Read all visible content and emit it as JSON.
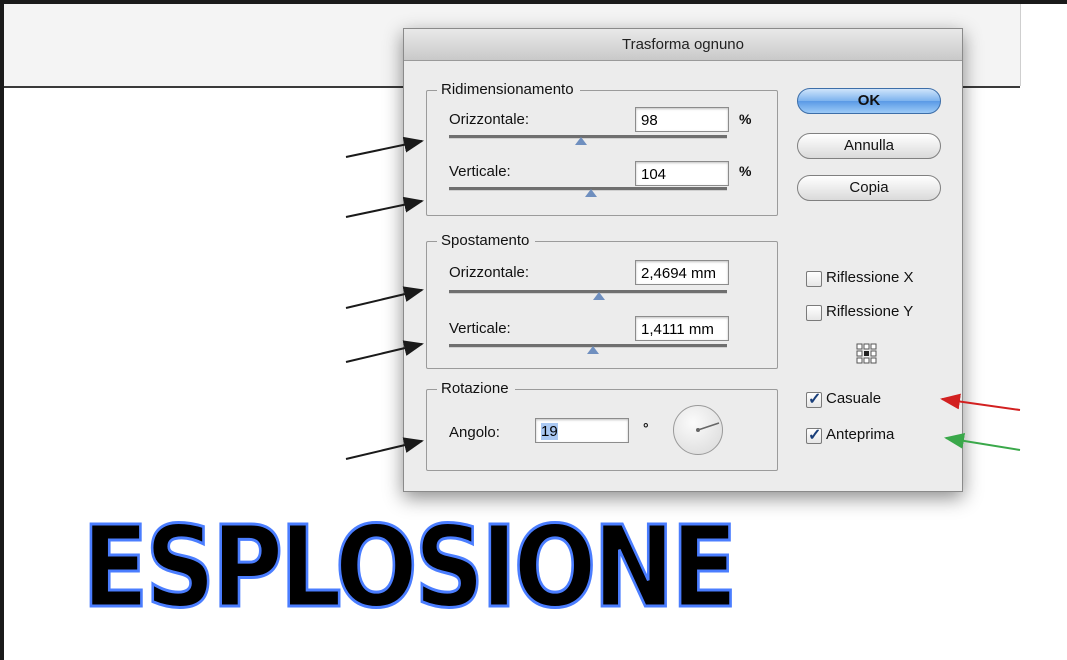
{
  "dialog": {
    "title": "Trasforma ognuno",
    "scale": {
      "label": "Ridimensionamento",
      "horizontal_label": "Orizzontale:",
      "horizontal_value": "98",
      "horizontal_unit": "%",
      "horizontal_slider_level": 0.49,
      "vertical_label": "Verticale:",
      "vertical_value": "104",
      "vertical_unit": "%",
      "vertical_slider_level": 0.52
    },
    "move": {
      "label": "Spostamento",
      "horizontal_label": "Orizzontale:",
      "horizontal_value": "2,4694 mm",
      "horizontal_slider_level": 0.53,
      "vertical_label": "Verticale:",
      "vertical_value": "1,4111 mm",
      "vertical_slider_level": 0.51
    },
    "rotate": {
      "label": "Rotazione",
      "angle_label": "Angolo:",
      "angle_value": "19",
      "angle_unit": "°",
      "dial_icon": "angle-dial-icon"
    },
    "buttons": {
      "ok": "OK",
      "cancel": "Annulla",
      "copy": "Copia"
    },
    "options": {
      "reflect_x": {
        "label": "Riflessione X",
        "checked": false
      },
      "reflect_y": {
        "label": "Riflessione Y",
        "checked": false
      },
      "reference_point_icon": "reference-point-grid-icon",
      "random": {
        "label": "Casuale",
        "checked": true
      },
      "preview": {
        "label": "Anteprima",
        "checked": true
      }
    }
  },
  "artwork": {
    "text": "ESPLOSIONE",
    "fill_color": "#000000",
    "path_color": "#4a7dff"
  },
  "annotations": {
    "arrow_color_black": "#1a1a1a",
    "arrow_color_red": "#d22020",
    "arrow_color_green": "#3aa84a"
  },
  "colors": {
    "default_button": "#5a9ae6",
    "dialog_bg": "#ececec"
  }
}
